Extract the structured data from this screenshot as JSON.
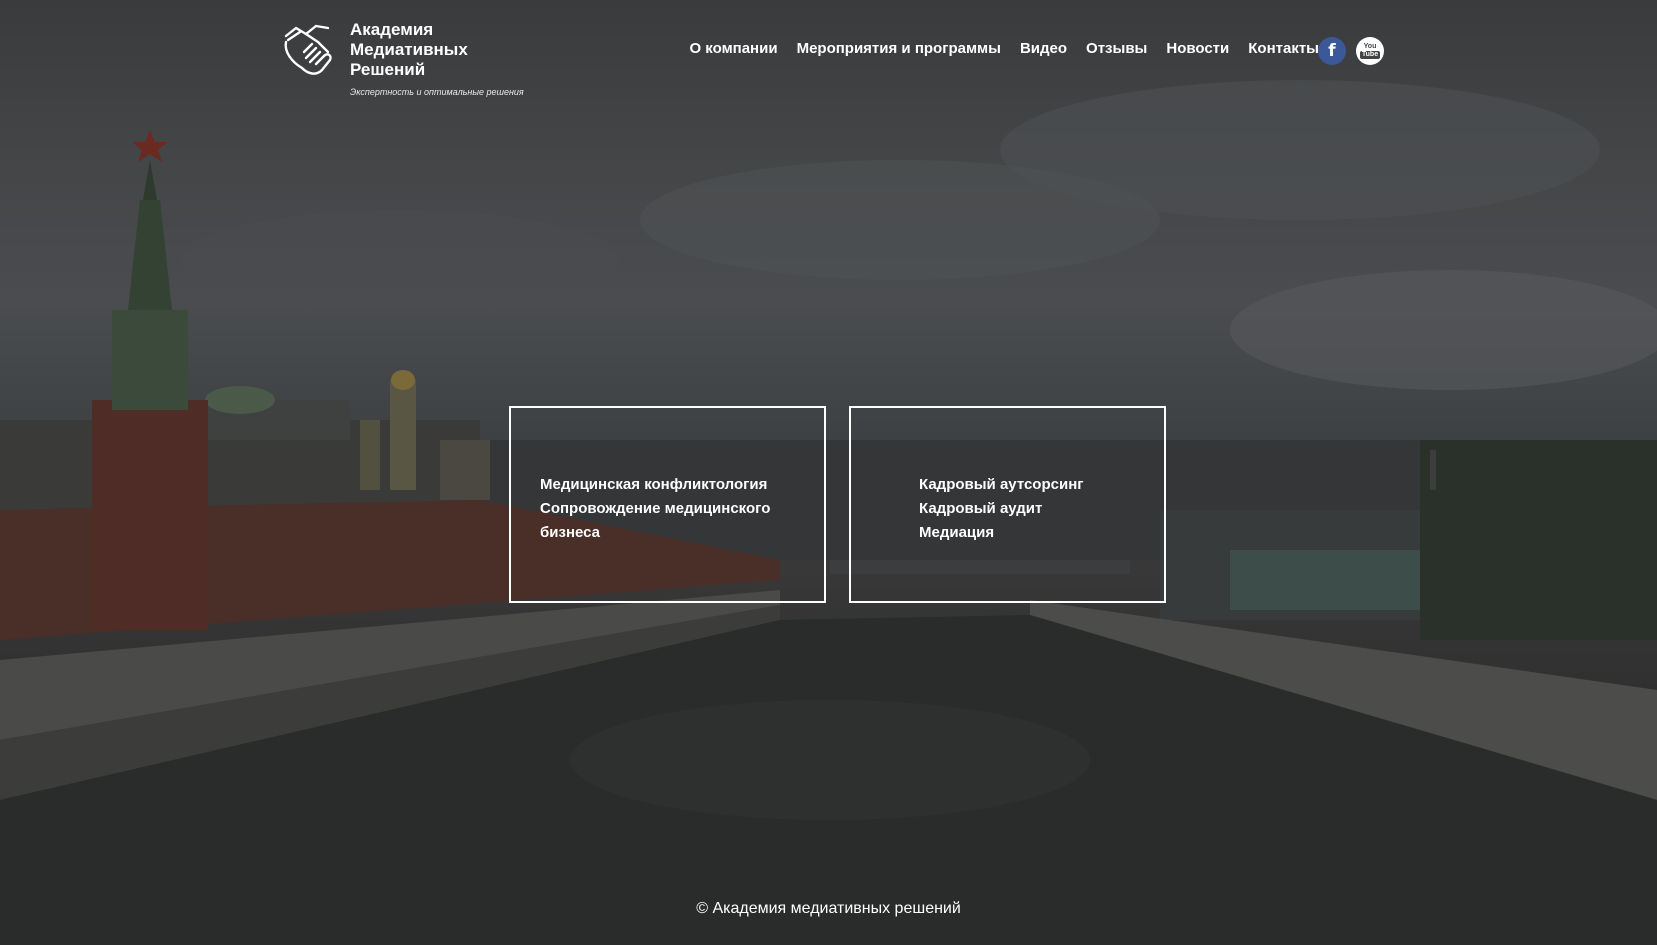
{
  "header": {
    "logo": {
      "title_lines": [
        "Академия",
        "Медиативных",
        "Решений"
      ],
      "tagline": "Экспертность и оптимальные решения",
      "icon": "handshake-icon"
    },
    "nav": [
      {
        "label": "О компании"
      },
      {
        "label": "Мероприятия и программы"
      },
      {
        "label": "Видео"
      },
      {
        "label": "Отзывы"
      },
      {
        "label": "Новости"
      },
      {
        "label": "Контакты"
      }
    ],
    "social": {
      "facebook": {
        "label": "f",
        "icon": "facebook-icon",
        "color": "#3b5998"
      },
      "youtube": {
        "label_top": "You",
        "label_bottom": "Tube",
        "icon": "youtube-icon"
      }
    }
  },
  "services": {
    "left": {
      "lines": [
        "Медицинская конфликтология",
        "Сопровождение медицинского",
        "бизнеса"
      ]
    },
    "right": {
      "lines": [
        "Кадровый аутсорсинг",
        "Кадровый аудит",
        "Медиация"
      ]
    }
  },
  "footer": {
    "copyright": "© Академия медиативных решений"
  },
  "colors": {
    "text": "#ffffff",
    "overlay": "#2f2f2f",
    "facebook": "#3b5998"
  }
}
